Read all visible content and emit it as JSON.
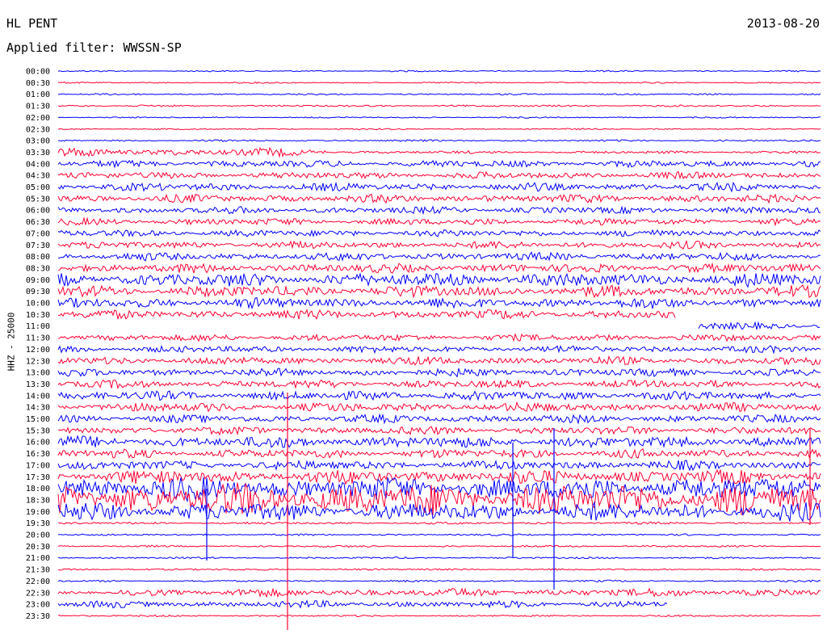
{
  "header": {
    "station": "HL PENT",
    "date": "2013-08-20",
    "filter_label": "Applied filter: WWSSN-SP"
  },
  "axis": {
    "ylabel": "HHZ - 25000"
  },
  "colors": {
    "trace_a": "#0000ff",
    "trace_b": "#ff0033"
  },
  "chart_data": {
    "type": "line",
    "ylabel": "HHZ - 25000",
    "xlabel": "",
    "rows": [
      {
        "time": "00:00",
        "amp": 0.6
      },
      {
        "time": "00:30",
        "amp": 0.6
      },
      {
        "time": "01:00",
        "amp": 0.7
      },
      {
        "time": "01:30",
        "amp": 0.8
      },
      {
        "time": "02:00",
        "amp": 0.6
      },
      {
        "time": "02:30",
        "amp": 0.6
      },
      {
        "time": "03:00",
        "amp": 0.8
      },
      {
        "time": "03:30",
        "amp": 1.2,
        "seg_start": 0.0,
        "seg_end": 0.35,
        "amp2": 3.5
      },
      {
        "time": "04:00",
        "amp": 3.0
      },
      {
        "time": "04:30",
        "amp": 3.0
      },
      {
        "time": "05:00",
        "amp": 3.5
      },
      {
        "time": "05:30",
        "amp": 3.5
      },
      {
        "time": "06:00",
        "amp": 3.0
      },
      {
        "time": "06:30",
        "amp": 3.0
      },
      {
        "time": "07:00",
        "amp": 3.0
      },
      {
        "time": "07:30",
        "amp": 3.2
      },
      {
        "time": "08:00",
        "amp": 3.5
      },
      {
        "time": "08:30",
        "amp": 4.0
      },
      {
        "time": "09:00",
        "amp": 6.0
      },
      {
        "time": "09:30",
        "amp": 5.0
      },
      {
        "time": "10:00",
        "amp": 4.5
      },
      {
        "time": "10:30",
        "amp": 4.0,
        "gap_start": 0.81
      },
      {
        "time": "11:00",
        "amp": 3.5,
        "gap_end": 0.84
      },
      {
        "time": "11:30",
        "amp": 3.0
      },
      {
        "time": "12:00",
        "amp": 3.0
      },
      {
        "time": "12:30",
        "amp": 3.5
      },
      {
        "time": "13:00",
        "amp": 3.5
      },
      {
        "time": "13:30",
        "amp": 3.5
      },
      {
        "time": "14:00",
        "amp": 4.0
      },
      {
        "time": "14:30",
        "amp": 4.0
      },
      {
        "time": "15:00",
        "amp": 3.5
      },
      {
        "time": "15:30",
        "amp": 3.5
      },
      {
        "time": "16:00",
        "amp": 5.0
      },
      {
        "time": "16:30",
        "amp": 4.0
      },
      {
        "time": "17:00",
        "amp": 4.0
      },
      {
        "time": "17:30",
        "amp": 6.0
      },
      {
        "time": "18:00",
        "amp": 10.0
      },
      {
        "time": "18:30",
        "amp": 14.0
      },
      {
        "time": "19:00",
        "amp": 8.0
      },
      {
        "time": "19:30",
        "amp": 1.0
      },
      {
        "time": "20:00",
        "amp": 0.8
      },
      {
        "time": "20:30",
        "amp": 0.8
      },
      {
        "time": "21:00",
        "amp": 0.8
      },
      {
        "time": "21:30",
        "amp": 0.8
      },
      {
        "time": "22:00",
        "amp": 0.8
      },
      {
        "time": "22:30",
        "amp": 3.5,
        "seg_start": 0.0,
        "seg_end": 0.08,
        "amp2": 1.0
      },
      {
        "time": "23:00",
        "amp": 3.0,
        "gap_tail": 0.8
      },
      {
        "time": "23:30",
        "amp": 0.8
      }
    ]
  }
}
